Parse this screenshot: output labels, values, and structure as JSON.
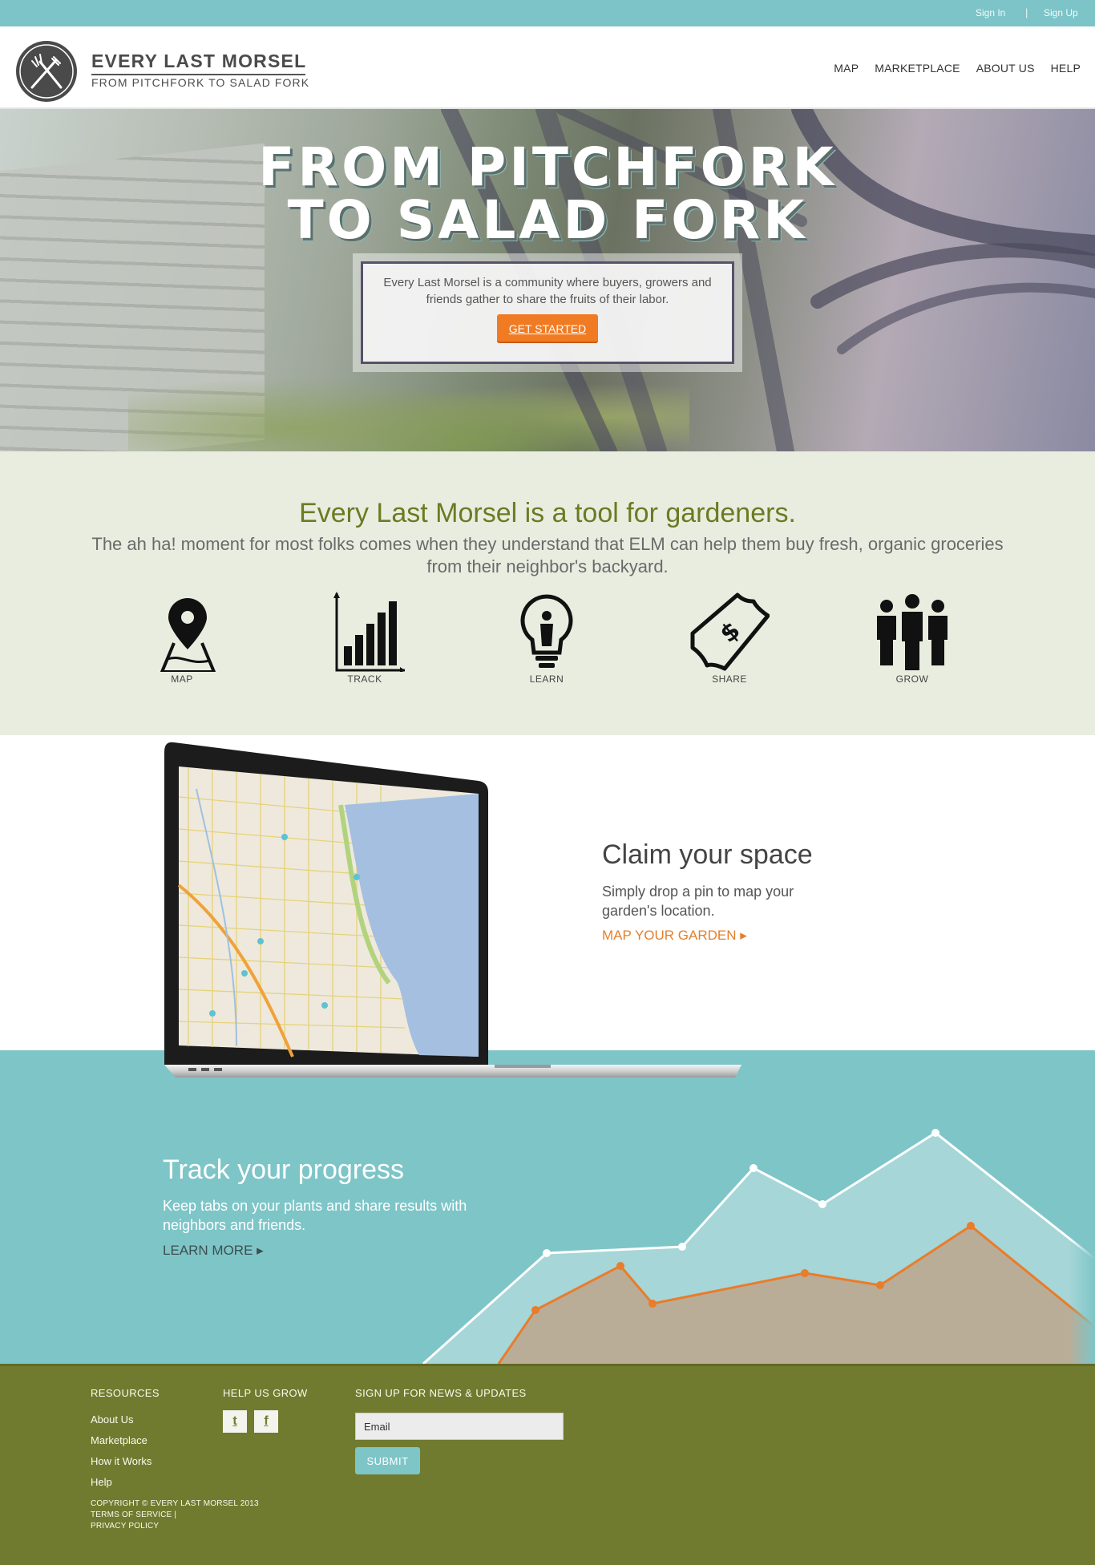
{
  "topbar": {
    "sign_in": "Sign In",
    "separator": "|",
    "sign_up": "Sign Up"
  },
  "header": {
    "brand_name": "EVERY LAST MORSEL",
    "brand_tagline": "FROM PITCHFORK TO SALAD FORK",
    "logo_icon": "fork-and-pitchfork-icon",
    "nav": [
      "MAP",
      "MARKETPLACE",
      "ABOUT US",
      "HELP"
    ]
  },
  "hero": {
    "title_line1": "FROM PITCHFORK",
    "title_line2": "TO SALAD FORK",
    "description": "Every Last Morsel is a community where buyers, growers and friends gather to share the fruits of their labor.",
    "cta": "GET STARTED"
  },
  "tools": {
    "heading": "Every Last Morsel is a tool for gardeners.",
    "subheading": "The ah ha! moment for most folks comes when they understand that ELM can help them buy fresh, organic groceries from their neighbor's backyard.",
    "items": [
      {
        "label": "MAP",
        "icon": "map-pin-icon"
      },
      {
        "label": "TRACK",
        "icon": "bar-chart-icon"
      },
      {
        "label": "LEARN",
        "icon": "lightbulb-icon"
      },
      {
        "label": "SHARE",
        "icon": "dollar-bill-icon"
      },
      {
        "label": "GROW",
        "icon": "people-icon"
      }
    ]
  },
  "claim": {
    "heading": "Claim your space",
    "text": "Simply drop a pin to map your garden's location.",
    "link": "MAP YOUR GARDEN ▸"
  },
  "track": {
    "heading": "Track your progress",
    "text": "Keep tabs on your plants and share results with neighbors and friends.",
    "link": "LEARN MORE ▸"
  },
  "footer": {
    "resources_title": "RESOURCES",
    "resources_links": [
      "About Us",
      "Marketplace",
      "How it Works",
      "Help"
    ],
    "help_title": "HELP US GROW",
    "social": [
      {
        "icon": "twitter-icon",
        "glyph": "t"
      },
      {
        "icon": "facebook-icon",
        "glyph": "f"
      }
    ],
    "newsletter_title": "SIGN UP FOR NEWS & UPDATES",
    "email_placeholder": "Email",
    "submit": "SUBMIT",
    "copyright": "COPYRIGHT © EVERY LAST MORSEL 2013",
    "terms": "TERMS OF SERVICE  |",
    "privacy": "PRIVACY POLICY"
  },
  "colors": {
    "teal": "#7ec5c8",
    "orange": "#f07b23",
    "olive": "#707b2f",
    "cream": "#e9ede0"
  }
}
